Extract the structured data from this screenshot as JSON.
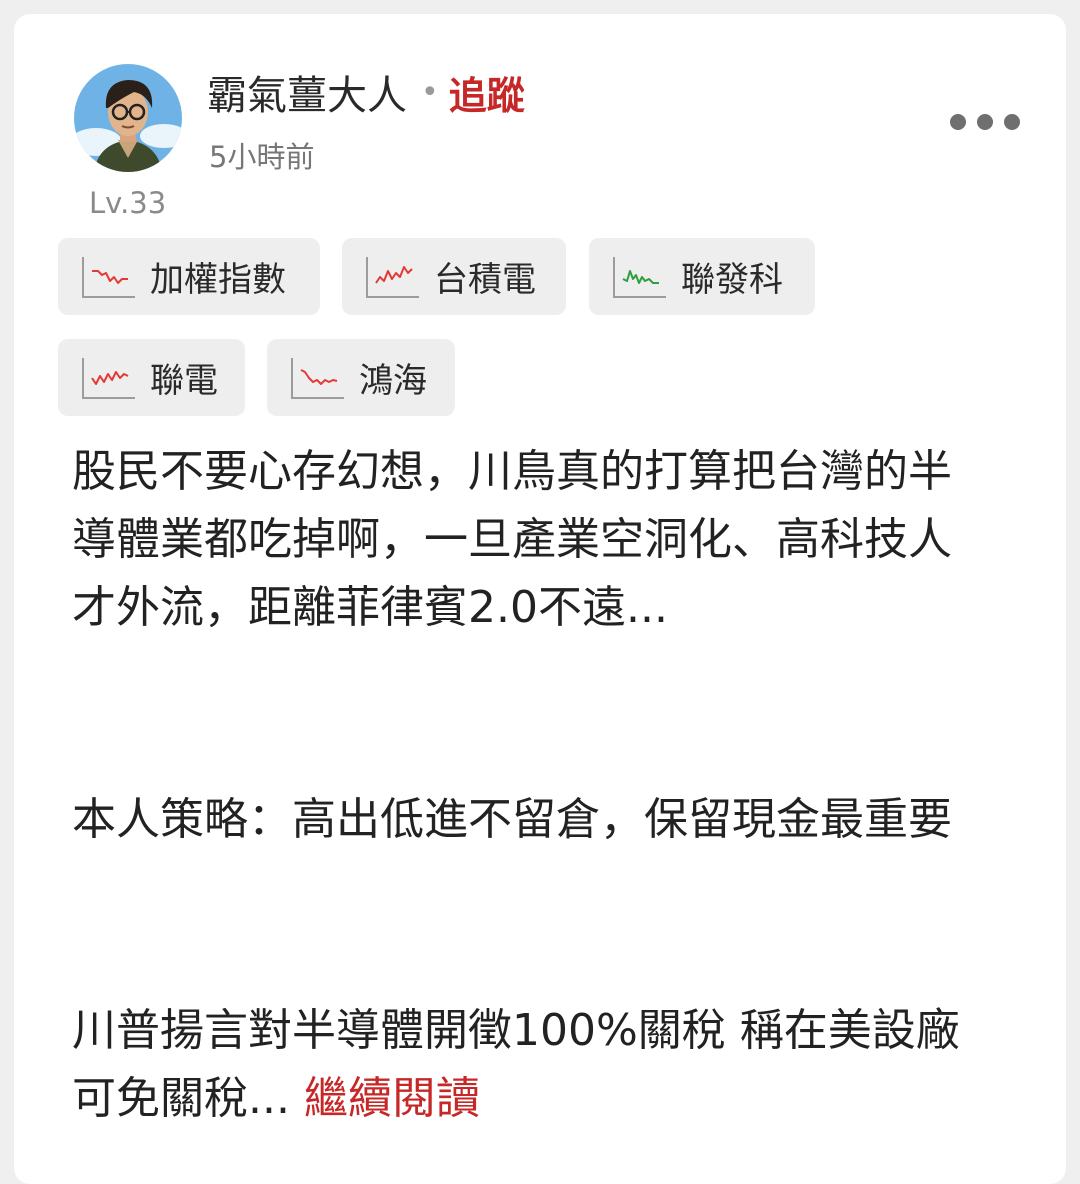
{
  "post": {
    "author": {
      "name": "霸氣薑大人",
      "separator": "•",
      "follow_label": "追蹤",
      "time": "5小時前",
      "level": "Lv.33",
      "avatar_icon": "avatar-portrait"
    },
    "more_icon": "more-dots-icon",
    "tags": [
      {
        "label": "加權指數",
        "trend_color": "#e53935",
        "icon": "mini-chart-icon"
      },
      {
        "label": "台積電",
        "trend_color": "#e53935",
        "icon": "mini-chart-icon"
      },
      {
        "label": "聯發科",
        "trend_color": "#2e9e3f",
        "icon": "mini-chart-icon"
      },
      {
        "label": "聯電",
        "trend_color": "#e53935",
        "icon": "mini-chart-icon"
      },
      {
        "label": "鴻海",
        "trend_color": "#e53935",
        "icon": "mini-chart-icon"
      }
    ],
    "body": {
      "p1_lines": [
        "股民不要心存幻想，川鳥真的打算把台灣的半",
        "導體業都吃掉啊，一旦產業空洞化、高科技人",
        "才外流，距離菲律賓2.0不遠..."
      ],
      "p2_lines": [
        "本人策略：高出低進不留倉，保留現金最重要"
      ],
      "p3_lines": [
        "川普揚言對半導體開徵100%關稅 稱在美設廠",
        "可免關稅..."
      ],
      "read_more": "繼續閱讀"
    }
  },
  "colors": {
    "accent_red": "#c62828",
    "trend_up": "#e53935",
    "trend_down": "#2e9e3f"
  }
}
